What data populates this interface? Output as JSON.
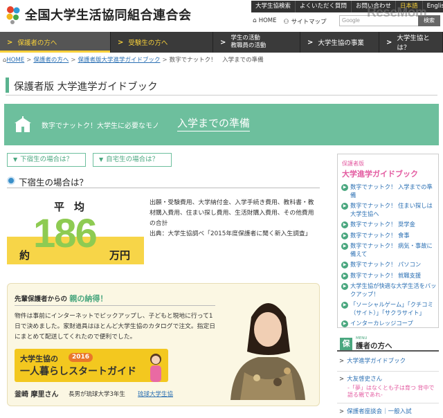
{
  "header": {
    "site_title": "全国大学生活協同組合連合会",
    "topnav": [
      "大学生協検索",
      "よくいただく質問",
      "お問い合わせ"
    ],
    "lang_ja": "日本語",
    "lang_en": "English",
    "home_link": "HOME",
    "sitemap_link": "サイトマップ",
    "search_placeholder": "Google",
    "search_button": "検索",
    "watermark": "ReseMom"
  },
  "mainnav": [
    {
      "label": "保護者の方へ",
      "active": true
    },
    {
      "label": "受験生の方へ"
    },
    {
      "label1": "学生の活動",
      "label2": "教職員の活動"
    },
    {
      "label": "大学生協の事業"
    },
    {
      "label": "大学生協とは？"
    }
  ],
  "breadcrumb": [
    "HOME",
    "保護者の方へ",
    "保護者版大学進学ガイドブック",
    "数字でナットク！　入学までの準備"
  ],
  "page_title": "保護者版 大学進学ガイドブック",
  "banner": {
    "lead": "数字でナットク！大学生に必要なモノ",
    "title": "入学までの準備"
  },
  "tabs": [
    "下宿生の場合は？",
    "自宅生の場合は？"
  ],
  "section_title": "下宿生の場合は？",
  "average": {
    "label": "平均",
    "prefix": "約",
    "value": "186",
    "unit": "万円",
    "description": "出願・受験費用、大学納付金、入学手続き費用、教科書・教材購入費用、住まい探し費用、生活財購入費用、その他費用の合計",
    "source": "出典：大学生協調べ「2015年度保護者に聞く新入生調査」"
  },
  "testimonial": {
    "head_prefix": "先輩保護者からの",
    "head_highlight": "親の納得！",
    "body": "物件は事前にインターネットでピックアップし、子どもと現地に行って1日で決めました。家財道具はほとんど大学生協のカタログで注文。指定日にまとめて配送してくれたので便利でした。",
    "promo_line1": "大学生協の",
    "promo_year": "2016",
    "promo_line2": "一人暮らしスタートガイド",
    "name": "釜崎 摩里さん",
    "relation": "長男が琉球大学3年生",
    "link": "琉球大学生協"
  },
  "sidebar": {
    "tag": "保護者版",
    "title": "大学進学ガイドブック",
    "items": [
      "数字でナットク！ 入学までの準備",
      "数字でナットク！ 住まい探しは大学生協へ",
      "数字でナットク！ 奨学金",
      "数字でナットク！ 食事",
      "数字でナットク！ 病気・事故に備えて",
      "数字でナットク！ パソコン",
      "数字でナットク！ 就職支援",
      "大学生協が快適な大学生活をバックアップ！",
      "「ソーシャルゲーム」「クチコミ（サイト）」「サクラサイト」",
      "インターカレッジコープ"
    ]
  },
  "sidebar2": {
    "kanji": "保",
    "menu": "MENU",
    "title": "護者の方へ",
    "item1": "大学進学ガイドブック",
    "item2": "大友啓史さん",
    "item2_sub": "-「夢」はなくとも子は育つ 背中で語る親であれ-",
    "item3": "保護者座談会｜一般入試"
  },
  "colors": {
    "accent_green": "#6dbf9d",
    "highlight_yellow": "#f7d548",
    "number_green": "#8ecb52",
    "link_blue": "#2a6fb3",
    "sidebar_pink": "#e35aa0"
  }
}
